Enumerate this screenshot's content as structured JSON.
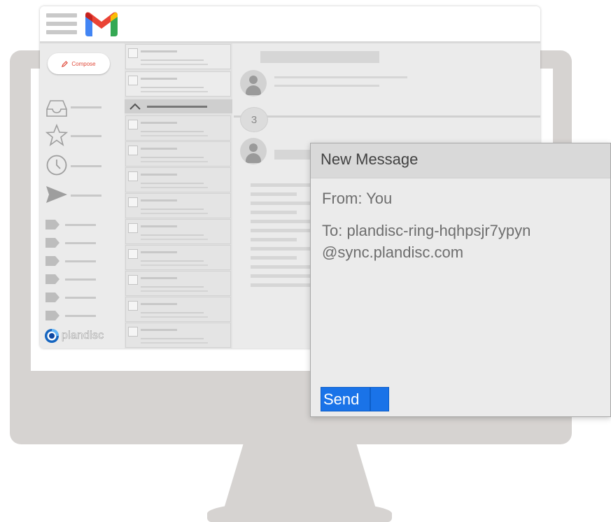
{
  "gmail": {
    "compose_label": "Compose",
    "brand_label": "plandisc",
    "thread_count": "3"
  },
  "new_message": {
    "title": "New Message",
    "from": "From: You",
    "to_line1": "To: plandisc-ring-hqhpsjr7ypyn",
    "to_line2": "@sync.plandisc.com",
    "send_label": "Send"
  },
  "colors": {
    "gmail_red": "#ea4335",
    "gmail_blue": "#4285f4",
    "gmail_green": "#34a853",
    "gmail_yellow": "#fbbc04",
    "send_blue": "#1a73e8",
    "monitor_gray": "#d6d3d1"
  },
  "icons": [
    "hamburger-menu-icon",
    "gmail-logo-icon",
    "pencil-icon",
    "inbox-icon",
    "star-icon",
    "clock-icon",
    "send-icon",
    "label-tag-icon",
    "chevron-up-icon",
    "person-icon",
    "plandisc-logo-icon"
  ]
}
